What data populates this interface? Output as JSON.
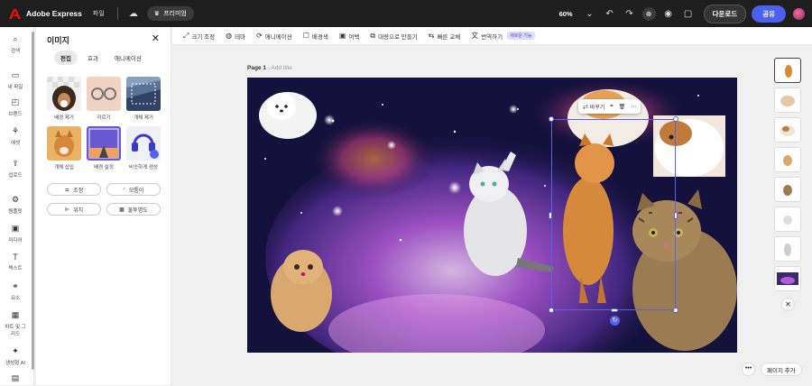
{
  "topbar": {
    "app_name": "Adobe Express",
    "file_menu": "파일",
    "premium_label": "프리미엄",
    "zoom": "60%",
    "download_label": "다운로드",
    "share_label": "공유"
  },
  "rail": {
    "items": [
      {
        "label": "검색",
        "icon": "search-icon"
      },
      {
        "label": "내 파일",
        "icon": "folder-icon"
      },
      {
        "label": "브랜드",
        "icon": "brand-icon"
      },
      {
        "label": "에셋",
        "icon": "assets-icon"
      },
      {
        "label": "업로드",
        "icon": "upload-icon"
      },
      {
        "label": "템플릿",
        "icon": "template-icon"
      },
      {
        "label": "미디어",
        "icon": "media-icon"
      },
      {
        "label": "텍스트",
        "icon": "text-icon"
      },
      {
        "label": "요소",
        "icon": "elements-icon"
      },
      {
        "label": "차트 및 그리드",
        "icon": "grid-icon"
      },
      {
        "label": "생성형 AI",
        "icon": "ai-icon"
      }
    ]
  },
  "panel": {
    "title": "이미지",
    "tabs": [
      "편집",
      "효과",
      "애니메이션"
    ],
    "tiles": [
      {
        "label": "배경 제거"
      },
      {
        "label": "자르기"
      },
      {
        "label": "개체 제거"
      },
      {
        "label": "개체 삽입"
      },
      {
        "label": "배경 설정"
      },
      {
        "label": "비슷하게 생성"
      }
    ],
    "buttons": [
      "조정",
      "모퉁이",
      "위치",
      "불투명도"
    ]
  },
  "toolbar": {
    "items": [
      "크기 조정",
      "테마",
      "애니메이션",
      "배경색",
      "여백",
      "대량으로 만들기",
      "빠른 교체",
      "번역하기"
    ],
    "new_badge": "새로운 기능"
  },
  "page": {
    "label": "Page 1",
    "title_placeholder": "Add title"
  },
  "object_toolbar": {
    "replace_label": "바꾸기"
  },
  "footer": {
    "add_page": "페이지 추가"
  }
}
